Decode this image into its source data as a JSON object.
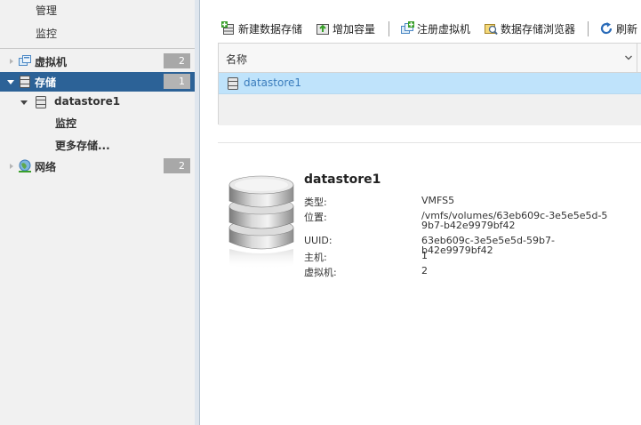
{
  "sidebar": {
    "items": [
      {
        "label": "管理"
      },
      {
        "label": "监控"
      },
      {
        "label": "虚拟机",
        "badge": "2"
      },
      {
        "label": "存储",
        "badge": "1"
      },
      {
        "label": "datastore1"
      },
      {
        "label": "监控"
      },
      {
        "label": "更多存储..."
      },
      {
        "label": "网络",
        "badge": "2"
      }
    ]
  },
  "toolbar": {
    "new_datastore": "新建数据存储",
    "increase_capacity": "增加容量",
    "register_vm": "注册虚拟机",
    "datastore_browser": "数据存储浏览器",
    "refresh": "刷新"
  },
  "grid": {
    "column_name": "名称",
    "rows": [
      {
        "name": "datastore1"
      }
    ]
  },
  "details": {
    "title": "datastore1",
    "fields": [
      {
        "label": "类型:",
        "value": "VMFS5"
      },
      {
        "label": "位置:",
        "value": "/vmfs/volumes/63eb609c-3e5e5e5d-59b7-b42e9979bf42"
      },
      {
        "label": "UUID:",
        "value": "63eb609c-3e5e5e5d-59b7-b42e9979bf42"
      },
      {
        "label": "主机:",
        "value": "1"
      },
      {
        "label": "虚拟机:",
        "value": "2"
      }
    ]
  },
  "colors": {
    "selected_nav": "#2c6297",
    "selected_row": "#bfe3fb",
    "link_text": "#3b7dbd"
  }
}
